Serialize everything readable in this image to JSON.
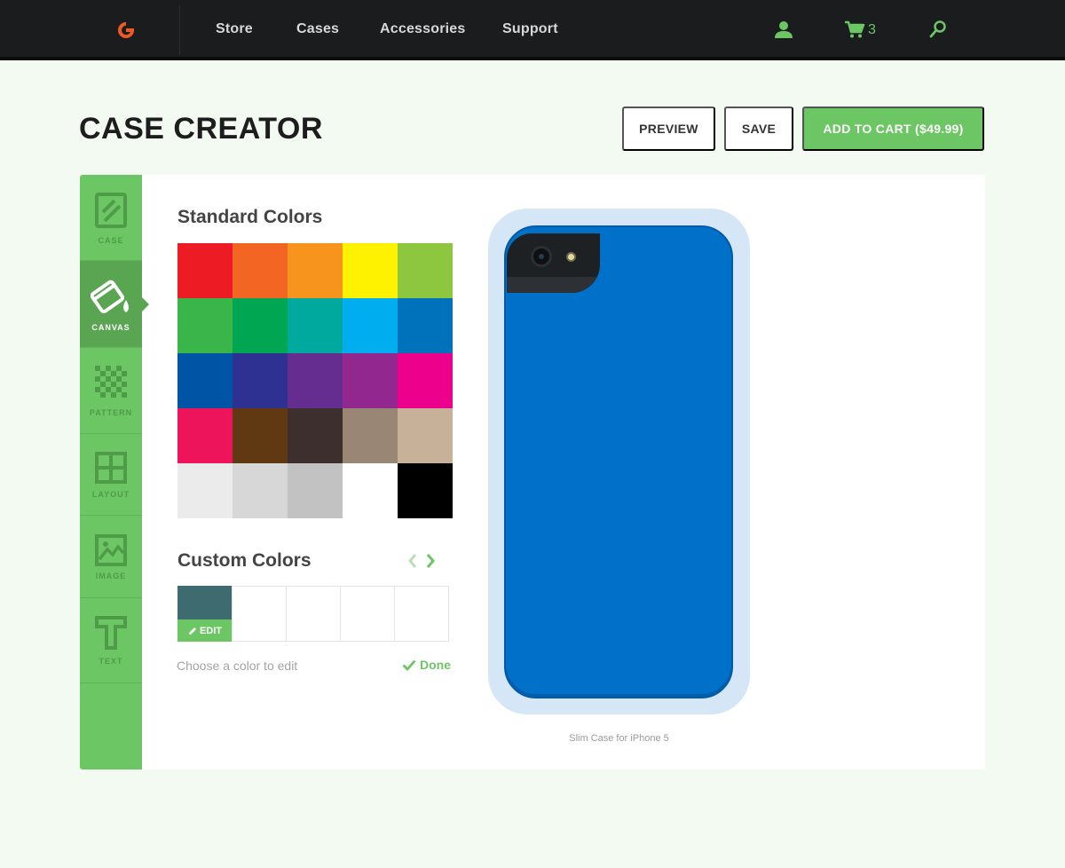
{
  "nav": {
    "logo": "g-logo",
    "items": [
      "Store",
      "Cases",
      "Accessories",
      "Support"
    ],
    "cart_count": "3",
    "icons": [
      "user-icon",
      "cart-icon",
      "search-icon"
    ],
    "accent": "#6cc664",
    "logo_color": "#ef5a24"
  },
  "header": {
    "title": "CASE CREATOR",
    "preview_label": "PREVIEW",
    "save_label": "SAVE",
    "add_to_cart_label": "ADD TO CART  ($49.99)"
  },
  "sidebar": {
    "items": [
      {
        "label": "CASE",
        "icon": "case-icon",
        "active": false
      },
      {
        "label": "CANVAS",
        "icon": "paint-bucket-icon",
        "active": true
      },
      {
        "label": "PATTERN",
        "icon": "pattern-icon",
        "active": false
      },
      {
        "label": "LAYOUT",
        "icon": "layout-icon",
        "active": false
      },
      {
        "label": "IMAGE",
        "icon": "image-icon",
        "active": false
      },
      {
        "label": "TEXT",
        "icon": "text-icon",
        "active": false
      }
    ]
  },
  "standard": {
    "title": "Standard Colors",
    "colors": [
      "#ed1c24",
      "#f26522",
      "#f7941d",
      "#fff200",
      "#8dc63f",
      "#39b54a",
      "#00a651",
      "#00a99d",
      "#00aeef",
      "#0072bc",
      "#0054a6",
      "#2e3192",
      "#662d91",
      "#92278f",
      "#ec008c",
      "#ed145b",
      "#603913",
      "#3c2f2d",
      "#998675",
      "#c7b299",
      "#ebebeb",
      "#d7d7d7",
      "#c2c2c2",
      "#ffffff",
      "#000000"
    ]
  },
  "custom": {
    "title": "Custom Colors",
    "edit_label": "EDIT",
    "hint": "Choose a color to edit",
    "done_label": "Done",
    "selected_color": "#3e6b70"
  },
  "preview": {
    "caption": "Slim Case for iPhone 5",
    "case_color": "#0070c9"
  }
}
